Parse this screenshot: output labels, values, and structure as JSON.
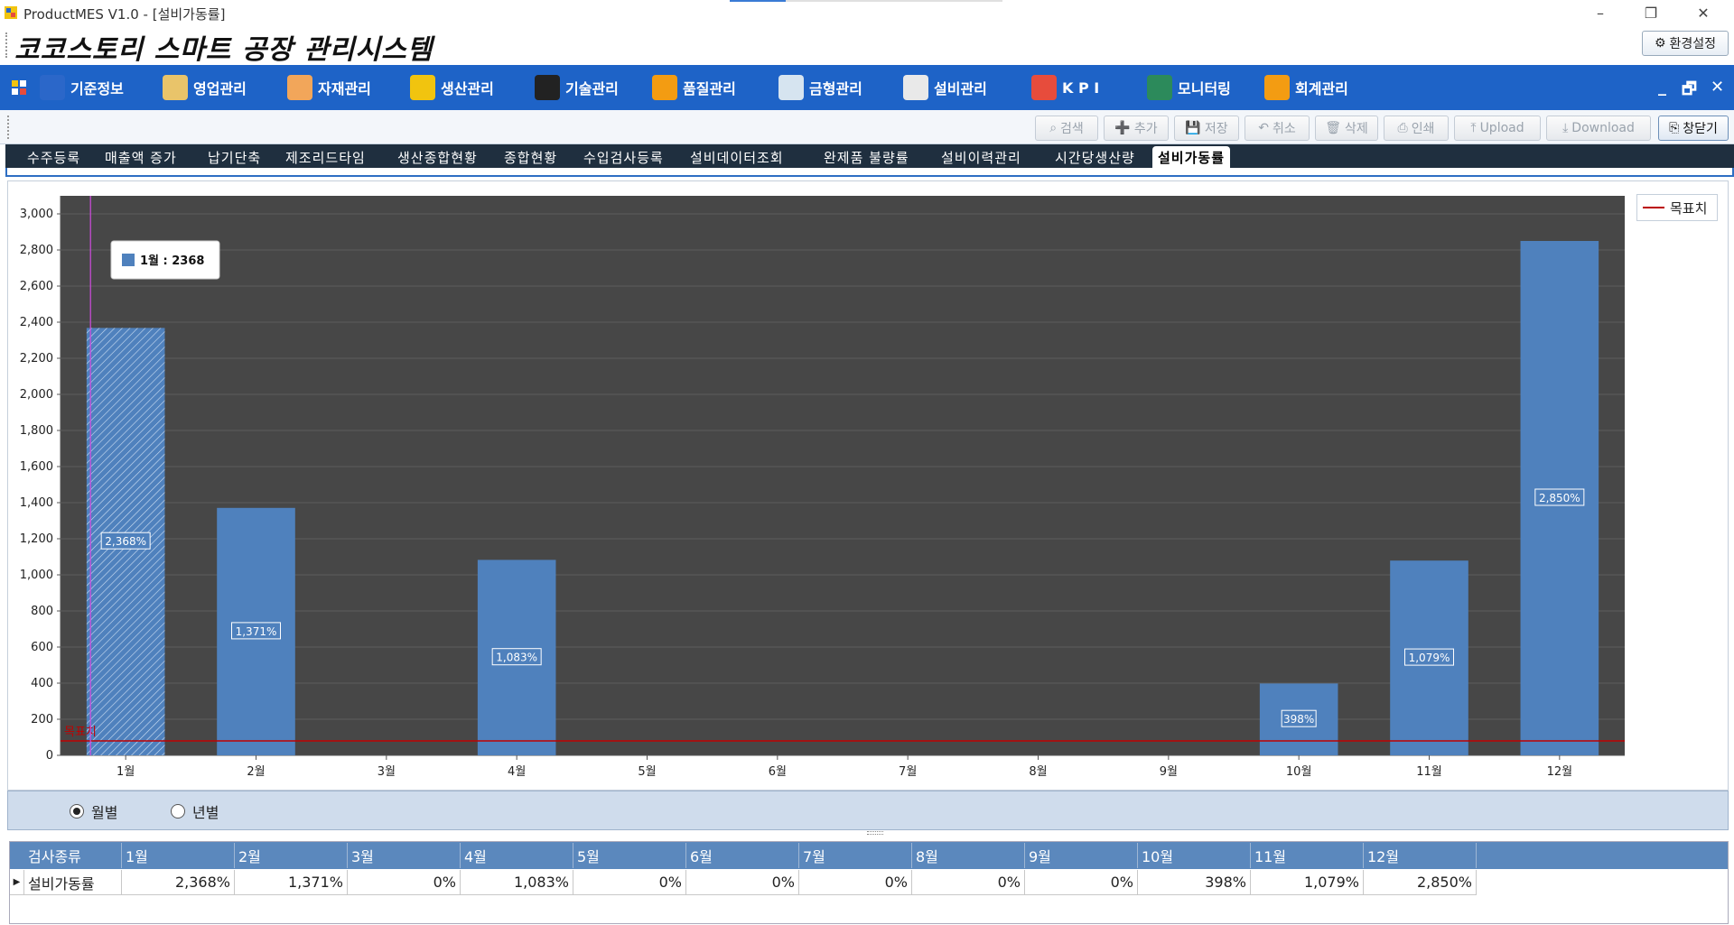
{
  "window": {
    "title": "ProductMES V1.0 - [설비가동률]",
    "controls": [
      "–",
      "❐",
      "✕"
    ]
  },
  "banner": {
    "title": "코코스토리 스마트 공장 관리시스템",
    "settings_label": "환경설정"
  },
  "menu": {
    "items": [
      {
        "label": "기준정보",
        "icon": "book-icon",
        "color": "#2b67c9"
      },
      {
        "label": "영업관리",
        "icon": "clipboard-icon",
        "color": "#e9c46a"
      },
      {
        "label": "자재관리",
        "icon": "box-icon",
        "color": "#f2a65a"
      },
      {
        "label": "생산관리",
        "icon": "coins-icon",
        "color": "#f1c40f"
      },
      {
        "label": "기술관리",
        "icon": "tools-icon",
        "color": "#222222"
      },
      {
        "label": "품질관리",
        "icon": "checklist-icon",
        "color": "#f39c12"
      },
      {
        "label": "금형관리",
        "icon": "sheet-icon",
        "color": "#d6e4f0"
      },
      {
        "label": "설비관리",
        "icon": "note-pin-icon",
        "color": "#e9e9e9"
      },
      {
        "label": "K P I",
        "icon": "bar-chart-icon",
        "color": "#e74c3c"
      },
      {
        "label": "모니터링",
        "icon": "monitor-icon",
        "color": "#2c8a5b"
      },
      {
        "label": "회계관리",
        "icon": "ledger-icon",
        "color": "#f39c12"
      }
    ],
    "right_controls": [
      "_",
      "🗗",
      "✕"
    ]
  },
  "toolbar": {
    "buttons": [
      {
        "label": "검색",
        "enabled": false
      },
      {
        "label": "추가",
        "enabled": false
      },
      {
        "label": "저장",
        "enabled": false
      },
      {
        "label": "취소",
        "enabled": false
      },
      {
        "label": "삭제",
        "enabled": false
      },
      {
        "label": "인쇄",
        "enabled": false
      },
      {
        "label": "Upload",
        "enabled": false
      },
      {
        "label": "Download",
        "enabled": false
      },
      {
        "label": "창닫기",
        "enabled": true
      }
    ]
  },
  "tabs": [
    {
      "label": "수주등록",
      "active": false
    },
    {
      "label": "매출액 증가",
      "active": false
    },
    {
      "label": "납기단축",
      "active": false
    },
    {
      "label": "제조리드타임",
      "active": false
    },
    {
      "label": "생산종합현황",
      "active": false
    },
    {
      "label": "종합현황",
      "active": false
    },
    {
      "label": "수입검사등록",
      "active": false
    },
    {
      "label": "설비데이터조회",
      "active": false
    },
    {
      "label": "완제품 불량률",
      "active": false
    },
    {
      "label": "설비이력관리",
      "active": false
    },
    {
      "label": "시간당생산량",
      "active": false
    },
    {
      "label": "설비가동률",
      "active": true
    }
  ],
  "chart_data": {
    "type": "bar",
    "categories": [
      "1월",
      "2월",
      "3월",
      "4월",
      "5월",
      "6월",
      "7월",
      "8월",
      "9월",
      "10월",
      "11월",
      "12월"
    ],
    "values": [
      2368,
      1371,
      0,
      1083,
      0,
      0,
      0,
      0,
      0,
      398,
      1079,
      2850
    ],
    "data_labels": [
      "2,368%",
      "1,371%",
      "",
      "1,083%",
      "",
      "",
      "",
      "",
      "",
      "398%",
      "1,079%",
      "2,850%"
    ],
    "ylim": [
      0,
      3100
    ],
    "yticks": [
      0,
      200,
      400,
      600,
      800,
      1000,
      1200,
      1400,
      1600,
      1800,
      2000,
      2200,
      2400,
      2600,
      2800,
      3000
    ],
    "ytick_labels": [
      "0",
      "200",
      "400",
      "600",
      "800",
      "1,000",
      "1,200",
      "1,400",
      "1,600",
      "1,800",
      "2,000",
      "2,200",
      "2,400",
      "2,600",
      "2,800",
      "3,000"
    ],
    "target_line": {
      "name": "목표치",
      "value": 80,
      "color": "#c00000"
    },
    "legend": {
      "entries": [
        "목표치"
      ],
      "placement": "top-right"
    },
    "tooltip": {
      "text": "1월 : 2368",
      "category_index": 0
    },
    "bar_color": "#4f81bd",
    "plot_bg": "#474747",
    "grid": true
  },
  "radios": {
    "options": [
      {
        "label": "월별",
        "checked": true
      },
      {
        "label": "년별",
        "checked": false
      }
    ]
  },
  "grid": {
    "headers": [
      "검사종류",
      "1월",
      "2월",
      "3월",
      "4월",
      "5월",
      "6월",
      "7월",
      "8월",
      "9월",
      "10월",
      "11월",
      "12월"
    ],
    "rows": [
      [
        "설비가동률",
        "2,368%",
        "1,371%",
        "0%",
        "1,083%",
        "0%",
        "0%",
        "0%",
        "0%",
        "0%",
        "398%",
        "1,079%",
        "2,850%"
      ]
    ]
  }
}
